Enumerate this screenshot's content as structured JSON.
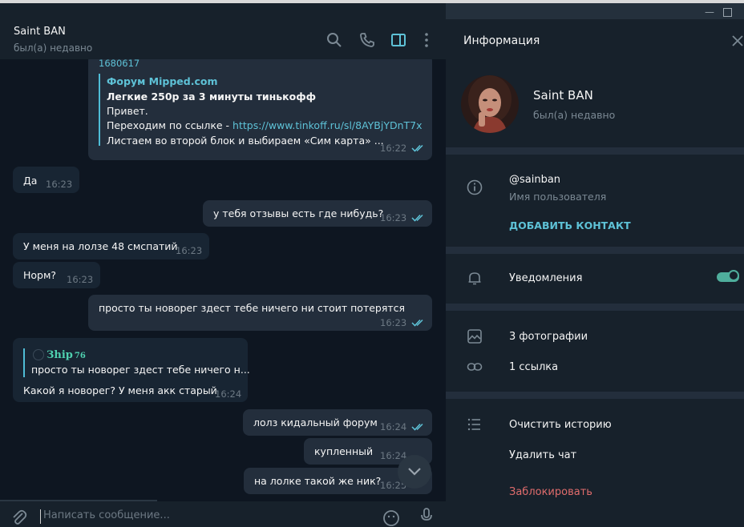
{
  "chat": {
    "name": "Saint BAN",
    "status": "был(а) недавно",
    "cut_text": "1680617",
    "forum_card": {
      "site": "Форум Mipped.com",
      "title": "Легкие 250р за 3 минуты тинькофф",
      "line1": "Привет.",
      "line2_prefix": "Переходим по ссылке - ",
      "line2_link": "https://www.tinkoff.ru/sl/8AYBjYDnT7x",
      "line3": "Листаем во второй блок и выбираем «Сим карта» ...",
      "time": "16:22"
    },
    "messages": [
      {
        "text": "Да",
        "time": "16:23"
      },
      {
        "text": "у тебя отзывы есть где нибудь?",
        "time": "16:23"
      },
      {
        "text": "У меня на лолзе 48 смспатий",
        "time": "16:23"
      },
      {
        "text": "Норм?",
        "time": "16:23"
      },
      {
        "text": "просто ты новорег здест тебе ничего ни стоит потерятся",
        "time": "16:23"
      },
      {
        "text": "Какой я новорег? У меня акк старый",
        "time": "16:24"
      },
      {
        "text": "лолз кидальный форум",
        "time": "16:24"
      },
      {
        "text": "купленный",
        "time": "16:24"
      },
      {
        "text": "на лолке такой же ник?",
        "time": "16:25"
      }
    ],
    "reply_quote": {
      "author": "Зhip",
      "author_suffix": "76",
      "text": "просто ты новорег здест тебе ничего н..."
    },
    "composer_placeholder": "Написать сообщение..."
  },
  "info": {
    "title": "Информация",
    "name": "Saint BAN",
    "status": "был(а) недавно",
    "username": "@sainban",
    "username_label": "Имя пользователя",
    "add_contact": "ДОБАВИТЬ КОНТАКТ",
    "notifications": "Уведомления",
    "notifications_on": true,
    "photos": "3 фотографии",
    "links": "1 ссылка",
    "clear_history": "Очистить историю",
    "delete_chat": "Удалить чат",
    "block": "Заблокировать"
  },
  "colors": {
    "accent": "#5ec2d7",
    "danger": "#e06c6c",
    "toggle": "#4fae9c"
  }
}
